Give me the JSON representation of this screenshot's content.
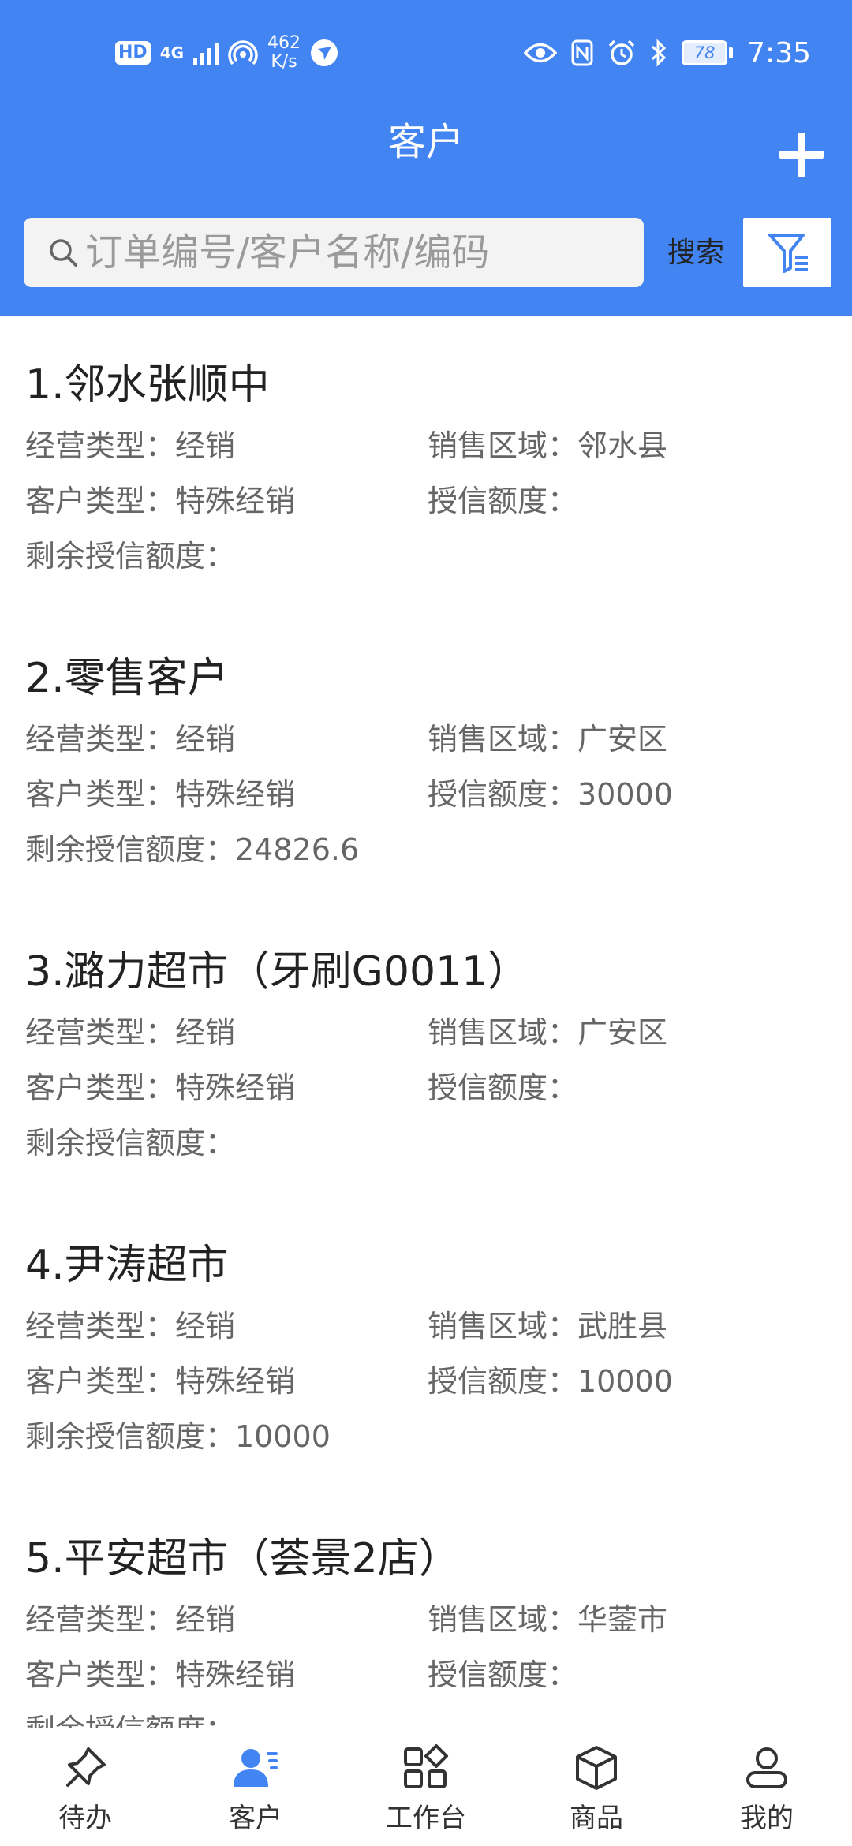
{
  "status_bar": {
    "network": "4G",
    "speed_value": "462",
    "speed_unit": "K/s",
    "battery": "78",
    "time": "7:35"
  },
  "header": {
    "title": "客户",
    "add_icon": "plus-icon"
  },
  "search": {
    "placeholder": "订单编号/客户名称/编码",
    "value": "",
    "button_label": "搜索",
    "filter_icon": "filter-icon"
  },
  "customers": [
    {
      "title": "1.邻水张顺中",
      "business_type": "经营类型：经销",
      "sales_area": "销售区域：邻水县",
      "customer_type": "客户类型：特殊经销",
      "credit_limit": "授信额度：",
      "remaining_credit": "剩余授信额度："
    },
    {
      "title": "2.零售客户",
      "business_type": "经营类型：经销",
      "sales_area": "销售区域：广安区",
      "customer_type": "客户类型：特殊经销",
      "credit_limit": "授信额度：30000",
      "remaining_credit": "剩余授信额度：24826.6"
    },
    {
      "title": "3.潞力超市（牙刷G0011）",
      "business_type": "经营类型：经销",
      "sales_area": "销售区域：广安区",
      "customer_type": "客户类型：特殊经销",
      "credit_limit": "授信额度：",
      "remaining_credit": "剩余授信额度："
    },
    {
      "title": "4.尹涛超市",
      "business_type": "经营类型：经销",
      "sales_area": "销售区域：武胜县",
      "customer_type": "客户类型：特殊经销",
      "credit_limit": "授信额度：10000",
      "remaining_credit": "剩余授信额度：10000"
    },
    {
      "title": "5.平安超市（荟景2店）",
      "business_type": "经营类型：经销",
      "sales_area": "销售区域：华蓥市",
      "customer_type": "客户类型：特殊经销",
      "credit_limit": "授信额度：",
      "remaining_credit": "剩余授信额度："
    }
  ],
  "bottom_nav": {
    "active_index": 1,
    "active_color": "#4284f2",
    "items": [
      {
        "label": "待办",
        "icon": "pin-icon"
      },
      {
        "label": "客户",
        "icon": "customer-icon"
      },
      {
        "label": "工作台",
        "icon": "workbench-icon"
      },
      {
        "label": "商品",
        "icon": "box-icon"
      },
      {
        "label": "我的",
        "icon": "user-icon"
      }
    ]
  }
}
